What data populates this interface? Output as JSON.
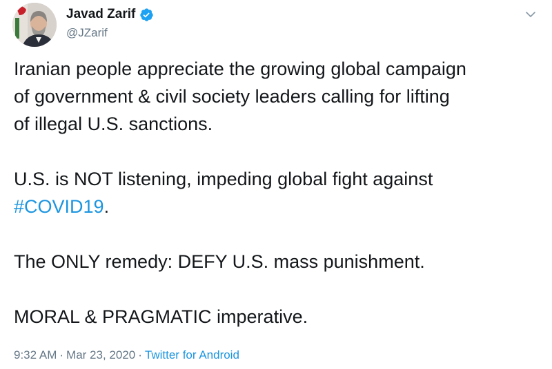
{
  "author": {
    "name": "Javad Zarif",
    "handle": "@JZarif",
    "verified": true
  },
  "tweet": {
    "p1": [
      "Iranian people appreciate the growing global campaign",
      "of government & civil society leaders calling for lifting",
      "of illegal U.S. sanctions."
    ],
    "p2_line1": "U.S. is NOT listening, impeding global fight against",
    "p2_hashtag": "#COVID19",
    "p2_tail": ".",
    "p3": "The ONLY remedy: DEFY U.S. mass punishment.",
    "p4": "MORAL & PRAGMATIC imperative."
  },
  "meta": {
    "time": "9:32 AM",
    "date": "Mar 23, 2020",
    "separator": "·",
    "source": "Twitter for Android"
  },
  "icons": {
    "verified": "verified-badge-icon",
    "menu": "chevron-down-icon"
  },
  "colors": {
    "link": "#1b95e0",
    "secondary": "#657786",
    "text": "#14171a"
  }
}
